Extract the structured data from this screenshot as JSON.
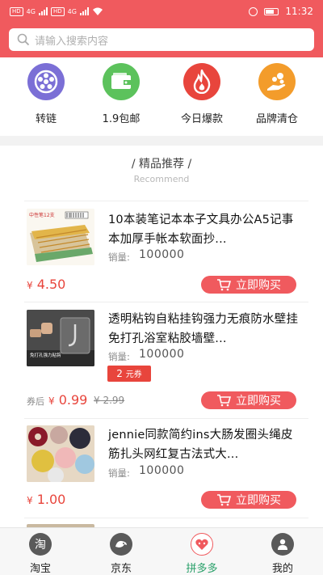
{
  "status_bar": {
    "time": "11:32",
    "left_chips": [
      "HD",
      "4G",
      "HD",
      "4G"
    ]
  },
  "search": {
    "placeholder": "请输入搜索内容"
  },
  "categories": [
    {
      "label": "转链",
      "icon": "reel-icon",
      "color": "#7b6fd6"
    },
    {
      "label": "1.9包邮",
      "icon": "wallet-icon",
      "color": "#5cc25c"
    },
    {
      "label": "今日爆款",
      "icon": "flame-icon",
      "color": "#e8453c"
    },
    {
      "label": "品牌清仓",
      "icon": "coins-hand-icon",
      "color": "#f39c2b"
    }
  ],
  "section": {
    "title": "/   精品推荐   /",
    "subtitle": "Recommend"
  },
  "products": [
    {
      "title": "10本装笔记本本子文具办公A5记事本加厚手帐本软面抄...",
      "sales_label": "销量:",
      "sales_value": "100000",
      "currency": "¥",
      "price": "4.50",
      "buy_label": "立即购买"
    },
    {
      "title": "透明粘钩自粘挂钩强力无痕防水壁挂免打孔浴室粘胶墙壁...",
      "sales_label": "销量:",
      "sales_value": "100000",
      "coupon_value": "2",
      "coupon_unit": "元券",
      "price_label": "券后",
      "currency": "¥",
      "price": "0.99",
      "original_price": "¥ 2.99",
      "buy_label": "立即购买"
    },
    {
      "title": "jennie同款简约ins大肠发圈头绳皮筋扎头网红复古法式大...",
      "sales_label": "销量:",
      "sales_value": "100000",
      "currency": "¥",
      "price": "1.00",
      "buy_label": "立即购买"
    }
  ],
  "tabs": [
    {
      "label": "淘宝",
      "icon_char": "淘",
      "icon": "taobao-icon"
    },
    {
      "label": "京东",
      "icon_char": "",
      "icon": "jd-dog-icon"
    },
    {
      "label": "拼多多",
      "icon_char": "",
      "icon": "pinduoduo-icon",
      "active": true
    },
    {
      "label": "我的",
      "icon_char": "",
      "icon": "profile-icon"
    }
  ]
}
